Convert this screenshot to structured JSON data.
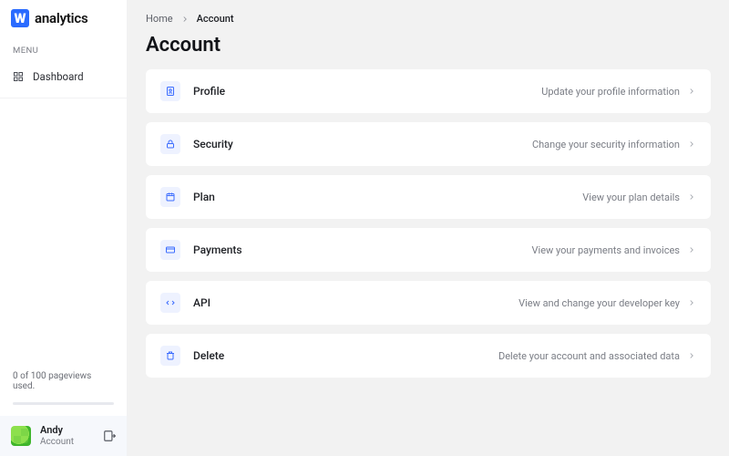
{
  "brand": {
    "mark": "W",
    "word": "analytics"
  },
  "sidebar": {
    "menu_label": "MENU",
    "items": [
      {
        "label": "Dashboard"
      }
    ],
    "usage_text": "0 of 100 pageviews used."
  },
  "user": {
    "name": "Andy",
    "sub": "Account"
  },
  "breadcrumb": {
    "home": "Home",
    "current": "Account"
  },
  "page": {
    "title": "Account"
  },
  "cards": [
    {
      "title": "Profile",
      "desc": "Update your profile information",
      "icon": "user"
    },
    {
      "title": "Security",
      "desc": "Change your security information",
      "icon": "lock"
    },
    {
      "title": "Plan",
      "desc": "View your plan details",
      "icon": "calendar"
    },
    {
      "title": "Payments",
      "desc": "View your payments and invoices",
      "icon": "card"
    },
    {
      "title": "API",
      "desc": "View and change your developer key",
      "icon": "code"
    },
    {
      "title": "Delete",
      "desc": "Delete your account and associated data",
      "icon": "trash"
    }
  ]
}
